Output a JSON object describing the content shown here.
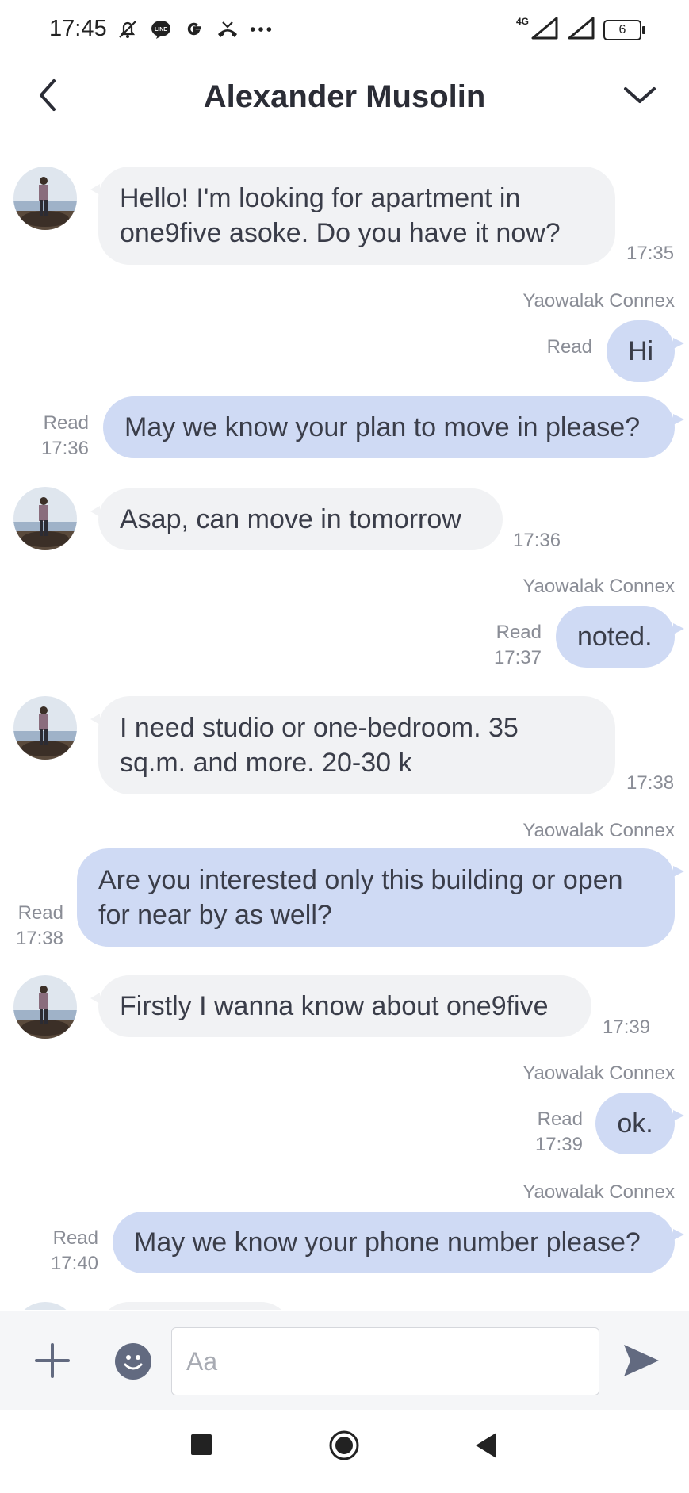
{
  "status_bar": {
    "time": "17:45",
    "icons": [
      "bell-off-icon",
      "line-app-icon",
      "google-icon",
      "missed-call-icon",
      "more-dots-icon"
    ],
    "network": "4G",
    "battery": "6"
  },
  "header": {
    "title": "Alexander Musolin"
  },
  "messages": [
    {
      "line1": "Hello! I'm looking for apartment in",
      "line2": "one9five asoke. Do you have it now?",
      "time": "17:35"
    },
    {
      "sender": "Yaowalak Connex",
      "text": "Hi",
      "read": "Read"
    },
    {
      "text": "May we know your plan to move in please?",
      "read": "Read",
      "time": "17:36"
    },
    {
      "text": "Asap, can move in tomorrow",
      "time": "17:36"
    },
    {
      "sender": "Yaowalak Connex",
      "text": "noted.",
      "read": "Read",
      "time": "17:37"
    },
    {
      "line1": "I need studio or one-bedroom. 35",
      "line2": "sq.m. and more. 20-30 k",
      "time": "17:38"
    },
    {
      "sender": "Yaowalak Connex",
      "line1": "Are you interested only this building or open",
      "line2": "for near by as well?",
      "read": "Read",
      "time": "17:38"
    },
    {
      "text": "Firstly I wanna know about one9five",
      "time": "17:39"
    },
    {
      "sender": "Yaowalak Connex",
      "text": "ok.",
      "read": "Read",
      "time": "17:39"
    },
    {
      "sender": "Yaowalak Connex",
      "text": "May we know your phone number please?",
      "read": "Read",
      "time": "17:40"
    }
  ],
  "input": {
    "placeholder": "Aa"
  },
  "colors": {
    "incoming_bubble": "#f1f2f4",
    "outgoing_bubble": "#cfdaf4",
    "icon": "#626a80"
  }
}
